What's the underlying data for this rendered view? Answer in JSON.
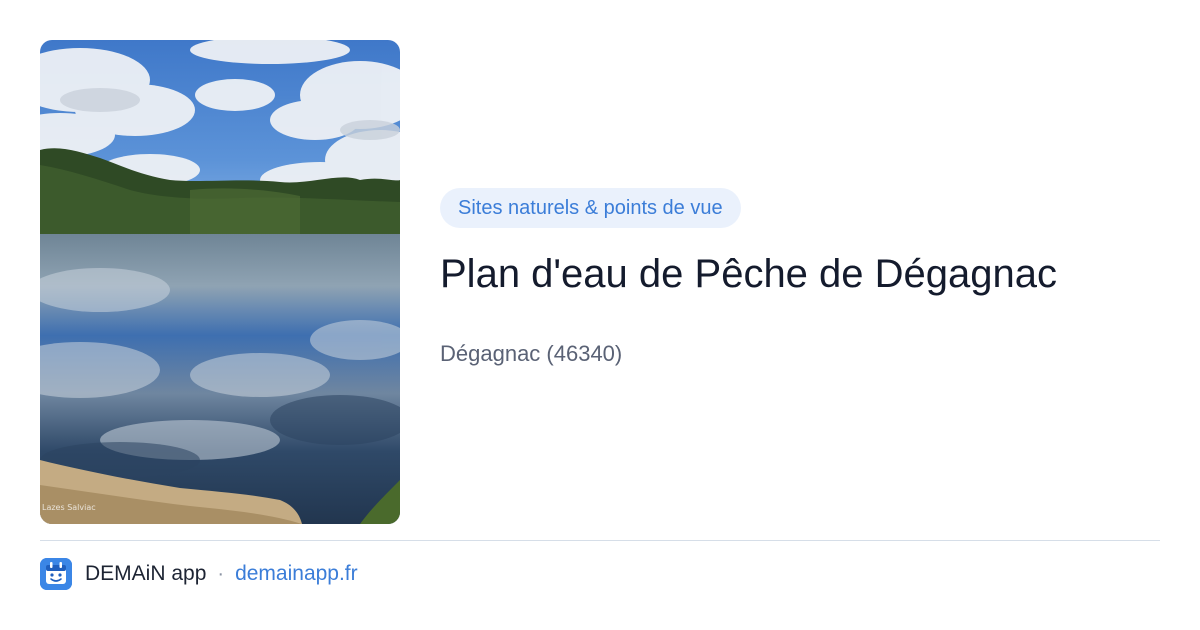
{
  "card": {
    "category": "Sites naturels & points de vue",
    "title": "Plan d'eau de Pêche de Dégagnac",
    "location": "Dégagnac (46340)",
    "photo_credit": "Lazes Salviac"
  },
  "footer": {
    "app_name": "DEMAiN app",
    "separator": "·",
    "domain": "demainapp.fr",
    "logo_icon": "demain-app-logo-icon"
  },
  "colors": {
    "accent": "#3b7dd8",
    "pill_background": "#eaf1fc",
    "title": "#141b2d",
    "muted_text": "#5a6275",
    "divider": "#d6dee8",
    "logo_background": "#3b86e6"
  }
}
